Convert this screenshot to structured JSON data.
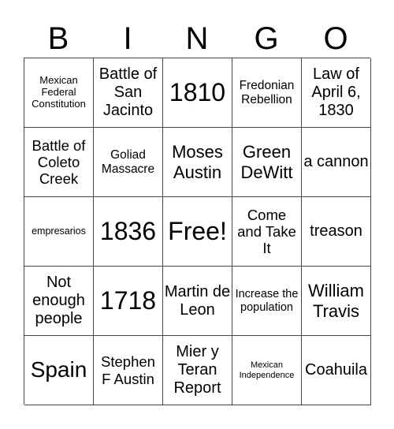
{
  "header": {
    "letters": [
      "B",
      "I",
      "N",
      "G",
      "O"
    ]
  },
  "board": {
    "cells": [
      "Mexican Federal Constitution",
      "Battle of San Jacinto",
      "1810",
      "Fredonian Rebellion",
      "Law of April 6, 1830",
      "Battle of Coleto Creek",
      "Goliad Massacre",
      "Moses Austin",
      "Green DeWitt",
      "a cannon",
      "empresarios",
      "1836",
      "Free!",
      "Come and Take It",
      "treason",
      "Not enough people",
      "1718",
      "Martin de Leon",
      "Increase the population",
      "William Travis",
      "Spain",
      "Stephen F Austin",
      "Mier y Teran Report",
      "Mexican Independence",
      "Coahuila"
    ]
  }
}
